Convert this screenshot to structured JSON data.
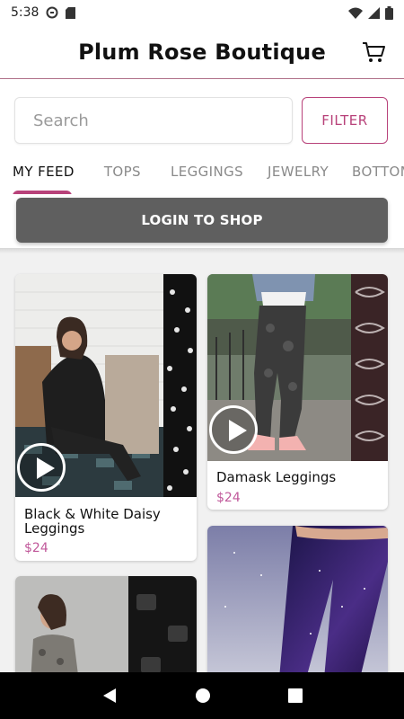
{
  "status_bar": {
    "time": "5:38"
  },
  "header": {
    "title": "Plum Rose Boutique"
  },
  "search": {
    "placeholder": "Search"
  },
  "filter": {
    "label": "FILTER"
  },
  "tabs": [
    {
      "label": "MY FEED",
      "active": true
    },
    {
      "label": "TOPS"
    },
    {
      "label": "LEGGINGS"
    },
    {
      "label": "JEWELRY"
    },
    {
      "label": "BOTTOM"
    }
  ],
  "login": {
    "label": "LOGIN TO SHOP"
  },
  "products": [
    {
      "name": "Black & White Daisy Leggings",
      "price": "$24"
    },
    {
      "name": "Damask Leggings",
      "price": "$24"
    },
    {
      "name": "",
      "price": ""
    },
    {
      "name": "",
      "price": ""
    }
  ],
  "colors": {
    "accent": "#b8427a",
    "price": "#c0589a",
    "login_bg": "#5f5f5f"
  }
}
